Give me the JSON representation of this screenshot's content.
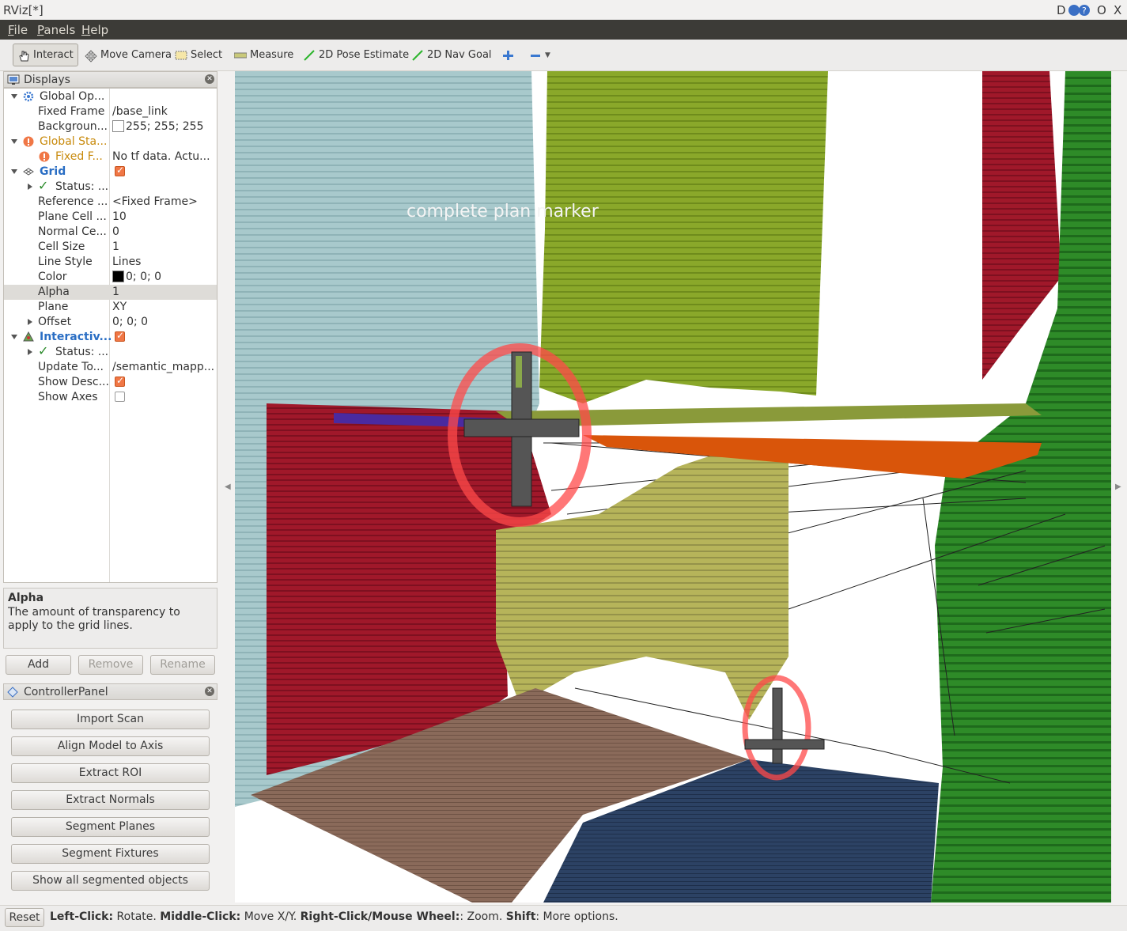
{
  "window": {
    "title": "RViz[*]",
    "controls": [
      "D",
      "?",
      "O",
      "X"
    ]
  },
  "menu": [
    {
      "label": "File",
      "underline": "F",
      "rest": "ile"
    },
    {
      "label": "Panels",
      "underline": "P",
      "rest": "anels"
    },
    {
      "label": "Help",
      "underline": "H",
      "rest": "elp"
    }
  ],
  "toolbar": {
    "interact": "Interact",
    "move_camera": "Move Camera",
    "select": "Select",
    "measure": "Measure",
    "pose_estimate": "2D Pose Estimate",
    "nav_goal": "2D Nav Goal",
    "add_icon": "plus-icon",
    "remove_icon": "minus-icon"
  },
  "displays": {
    "title": "Displays",
    "rows": [
      {
        "key": "Global Op...",
        "value": ""
      },
      {
        "key": "Fixed Frame",
        "value": "/base_link"
      },
      {
        "key": "Backgroun...",
        "value": "255; 255; 255"
      },
      {
        "key": "Global Sta...",
        "value": ""
      },
      {
        "key": "Fixed F...",
        "value": "No tf data.  Actu..."
      },
      {
        "key": "Grid",
        "value": ""
      },
      {
        "key": "Status: ...",
        "value": ""
      },
      {
        "key": "Reference ...",
        "value": "<Fixed Frame>"
      },
      {
        "key": "Plane Cell ...",
        "value": "10"
      },
      {
        "key": "Normal Ce...",
        "value": "0"
      },
      {
        "key": "Cell Size",
        "value": "1"
      },
      {
        "key": "Line Style",
        "value": "Lines"
      },
      {
        "key": "Color",
        "value": "0; 0; 0"
      },
      {
        "key": "Alpha",
        "value": "1"
      },
      {
        "key": "Plane",
        "value": "XY"
      },
      {
        "key": "Offset",
        "value": "0; 0; 0"
      },
      {
        "key": "Interactiv...",
        "value": ""
      },
      {
        "key": "Status: ...",
        "value": ""
      },
      {
        "key": "Update To...",
        "value": "/semantic_mapp..."
      },
      {
        "key": "Show Desc...",
        "value": ""
      },
      {
        "key": "Show Axes",
        "value": ""
      }
    ],
    "checks": {
      "grid": true,
      "interactive": true,
      "show_desc": true,
      "show_axes": false
    }
  },
  "description": {
    "title": "Alpha",
    "body": "The amount of transparency to apply to the grid lines."
  },
  "display_buttons": {
    "add": "Add",
    "remove": "Remove",
    "rename": "Rename"
  },
  "controller": {
    "title": "ControllerPanel",
    "buttons": [
      "Import Scan",
      "Align Model to Axis",
      "Extract ROI",
      "Extract Normals",
      "Segment Planes",
      "Segment Fixtures",
      "Show all segmented objects"
    ]
  },
  "viewport": {
    "marker_text": "complete  plan    marker",
    "colors": {
      "teal": "#a8c9cc",
      "olive": "#8aa82a",
      "red": "#a0182a",
      "green": "#2e8b28",
      "khaki": "#b6b45a",
      "brown": "#8a6a5a",
      "navy": "#2c4264",
      "orange": "#d9550a",
      "purple": "#4a2aa0"
    }
  },
  "status": {
    "reset": "Reset",
    "b1": "Left-Click:",
    "t1": " Rotate. ",
    "b2": "Middle-Click:",
    "t2": " Move X/Y. ",
    "b3": "Right-Click/Mouse Wheel:",
    "t3": ": Zoom. ",
    "b4": "Shift",
    "t4": ": More options."
  }
}
